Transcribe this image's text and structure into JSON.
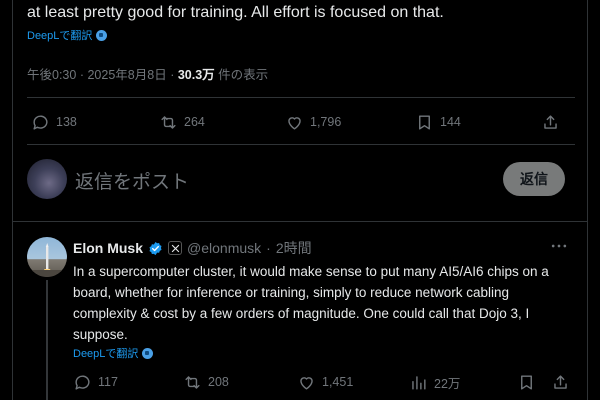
{
  "tweet": {
    "text_tail": "at least pretty good for training. All effort is focused on that.",
    "translate_label": "DeepLで翻訳",
    "meta": {
      "time": "午後0:30",
      "dot1": "·",
      "date": "2025年8月8日",
      "dot2": "·",
      "views": "30.3万",
      "views_suffix": "件の表示"
    },
    "actions": {
      "replies": "138",
      "reposts": "264",
      "likes": "1,796",
      "bookmarks": "144"
    }
  },
  "reply_box": {
    "placeholder": "返信をポスト",
    "button_label": "返信"
  },
  "reply": {
    "name": "Elon Musk",
    "handle": "@elonmusk",
    "dot": "·",
    "time": "2時間",
    "text": "In a supercomputer cluster, it would make sense to put many AI5/AI6 chips on a board, whether for inference or training, simply to reduce network cabling complexity & cost by a few orders of magnitude. One could call that Dojo 3, I suppose.",
    "translate_label": "DeepLで翻訳",
    "actions": {
      "replies": "117",
      "reposts": "208",
      "likes": "1,451",
      "views": "22万"
    }
  },
  "colors": {
    "background": "#000000",
    "text": "#e7e9ea",
    "muted": "#71767b",
    "link": "#1d9bf0",
    "verified": "#1d9bf0",
    "border": "#2f3336"
  }
}
